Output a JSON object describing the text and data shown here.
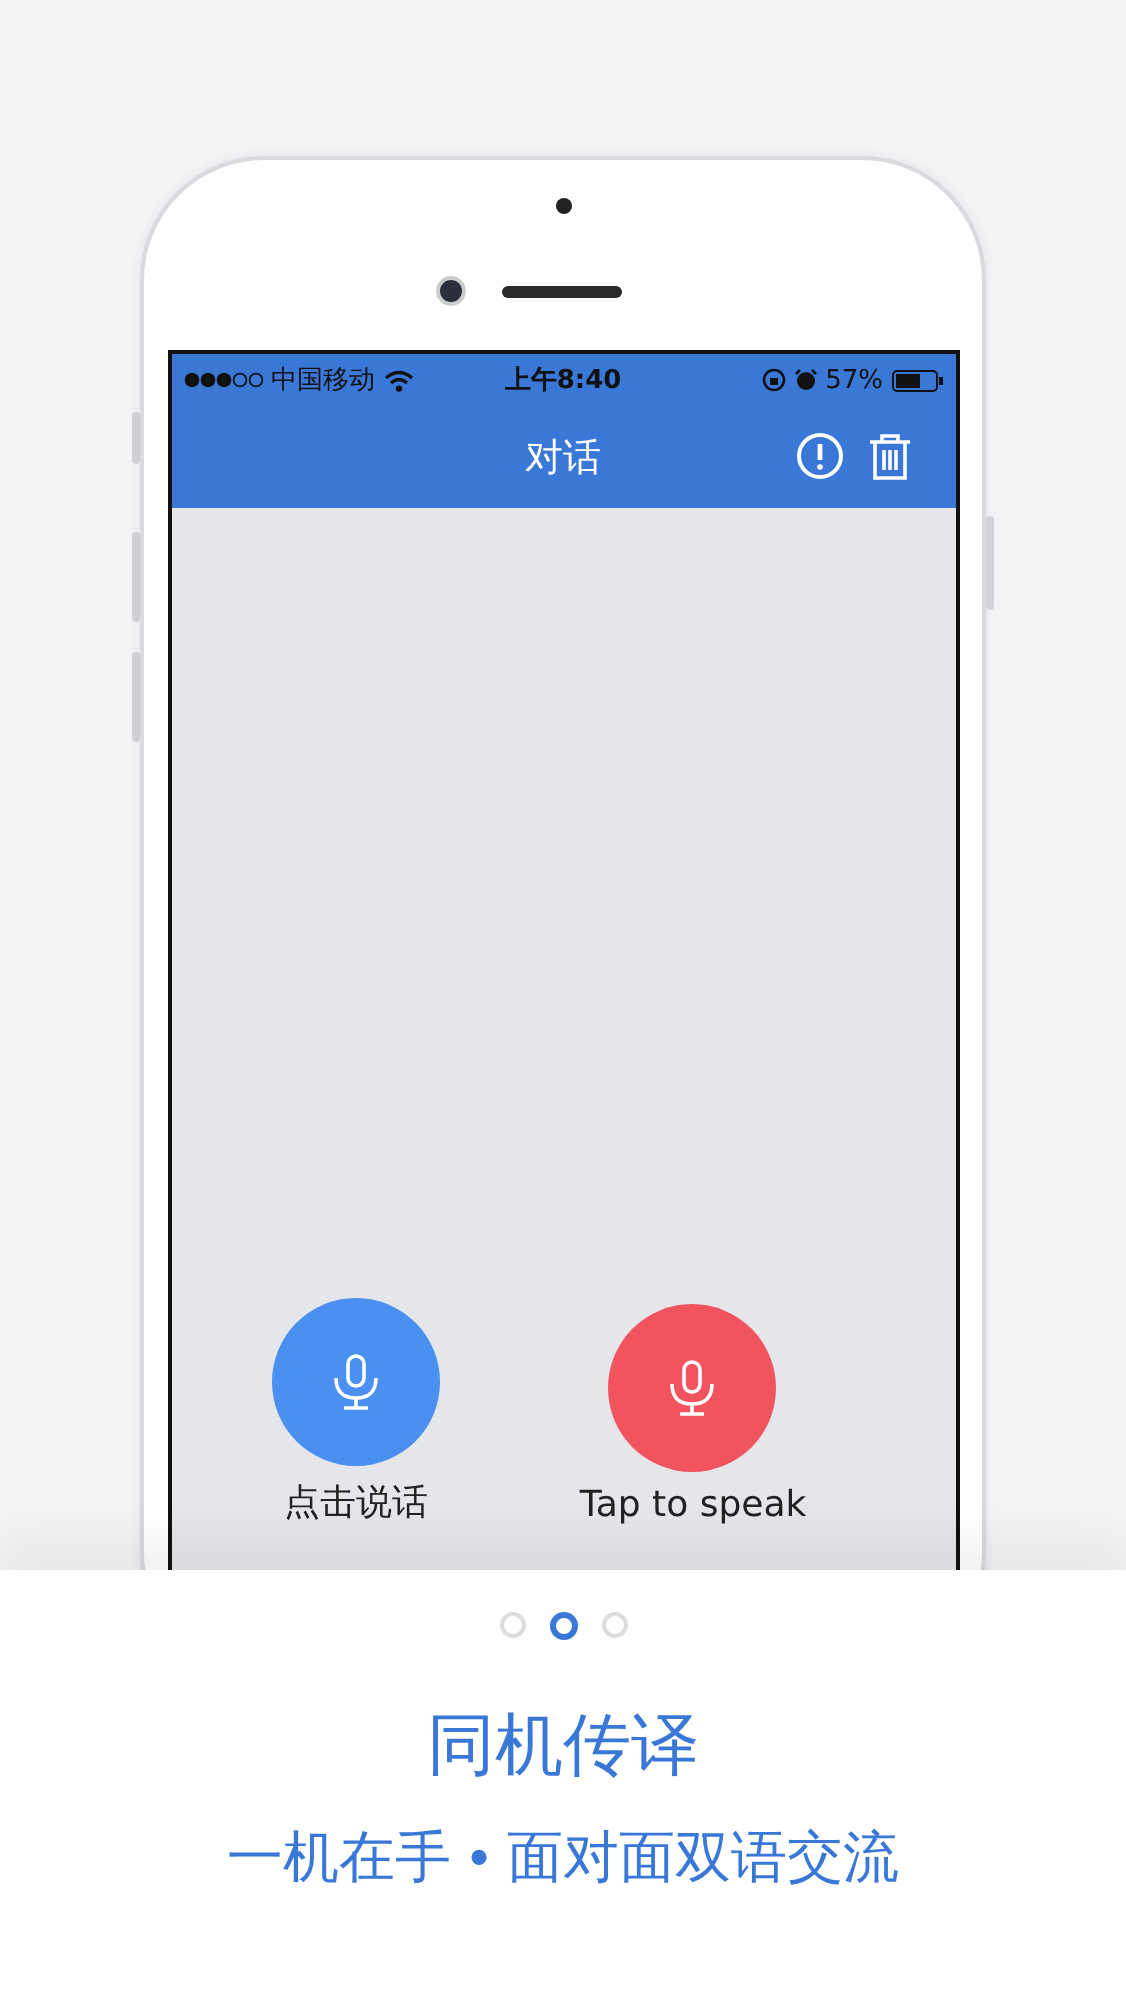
{
  "status_bar": {
    "carrier": "中国移动",
    "time": "上午8:40",
    "battery": "57%"
  },
  "nav_bar": {
    "title": "对话"
  },
  "speak_buttons": [
    {
      "label": "点击说话",
      "color": "#4a90f0"
    },
    {
      "label": "Tap to speak",
      "color": "#f2545f"
    }
  ],
  "pager": [
    {
      "selected": false
    },
    {
      "selected": true
    },
    {
      "selected": false
    }
  ],
  "heading": "同机传译",
  "subtitle": "一机在手 • 面对面双语交流"
}
